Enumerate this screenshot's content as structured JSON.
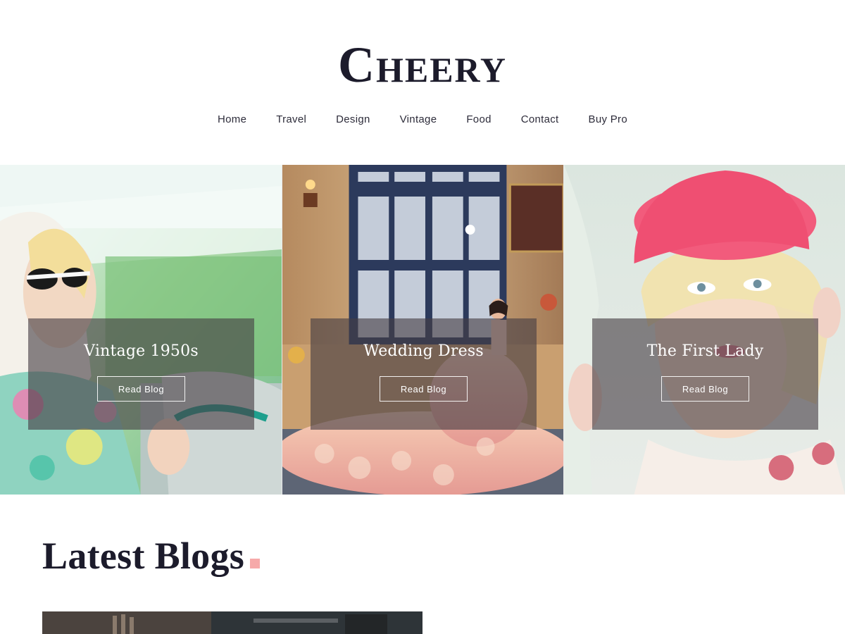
{
  "site": {
    "logo": "Cheery"
  },
  "nav": {
    "items": [
      "Home",
      "Travel",
      "Design",
      "Vintage",
      "Food",
      "Contact",
      "Buy Pro"
    ]
  },
  "slider": {
    "slides": [
      {
        "title": "Vintage 1950s",
        "button": "Read Blog"
      },
      {
        "title": "Wedding Dress",
        "button": "Read Blog"
      },
      {
        "title": "The First Lady",
        "button": "Read Blog"
      }
    ]
  },
  "latest": {
    "title": "Latest Blogs"
  },
  "colors": {
    "text": "#1c1b2b",
    "accent": "#f6a9a9",
    "overlay": "#463e44"
  }
}
